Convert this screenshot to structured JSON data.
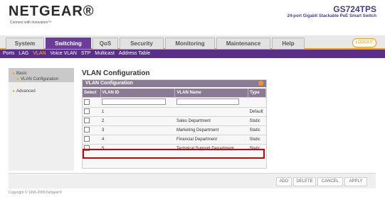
{
  "brand": {
    "logo": "NETGEAR®",
    "tagline": "Connect with Innovation™"
  },
  "device": {
    "model": "GS724TPS",
    "description": "24-port Gigabit Stackable PoE Smart Switch"
  },
  "tabs": [
    {
      "label": "System"
    },
    {
      "label": "Switching"
    },
    {
      "label": "QoS"
    },
    {
      "label": "Security"
    },
    {
      "label": "Monitoring"
    },
    {
      "label": "Maintenance"
    },
    {
      "label": "Help"
    }
  ],
  "logout_label": "LOGOUT",
  "subnav": [
    {
      "label": "Ports"
    },
    {
      "label": "LAG"
    },
    {
      "label": "VLAN"
    },
    {
      "label": "Voice VLAN"
    },
    {
      "label": "STP"
    },
    {
      "label": "Multicast"
    },
    {
      "label": "Address Table"
    }
  ],
  "left_nav": {
    "basic": "Basic",
    "vlan_config": "VLAN Configuration",
    "advanced": "Advanced"
  },
  "page_title": "VLAN Configuration",
  "panel_title": "VLAN Configuration",
  "table": {
    "headers": [
      "Select",
      "VLAN ID",
      "VLAN Name",
      "Type"
    ],
    "rows": [
      {
        "id": "1",
        "name": "",
        "type": "Default"
      },
      {
        "id": "2",
        "name": "Sales Department",
        "type": "Static"
      },
      {
        "id": "3",
        "name": "Marketing Department",
        "type": "Static"
      },
      {
        "id": "4",
        "name": "Financial Department",
        "type": "Static"
      },
      {
        "id": "5",
        "name": "Technical Support Department",
        "type": "Static"
      }
    ]
  },
  "buttons": {
    "add": "ADD",
    "delete": "DELETE",
    "cancel": "CANCEL",
    "apply": "APPLY"
  },
  "copyright": "Copyright © 1996-2009 Netgear®"
}
